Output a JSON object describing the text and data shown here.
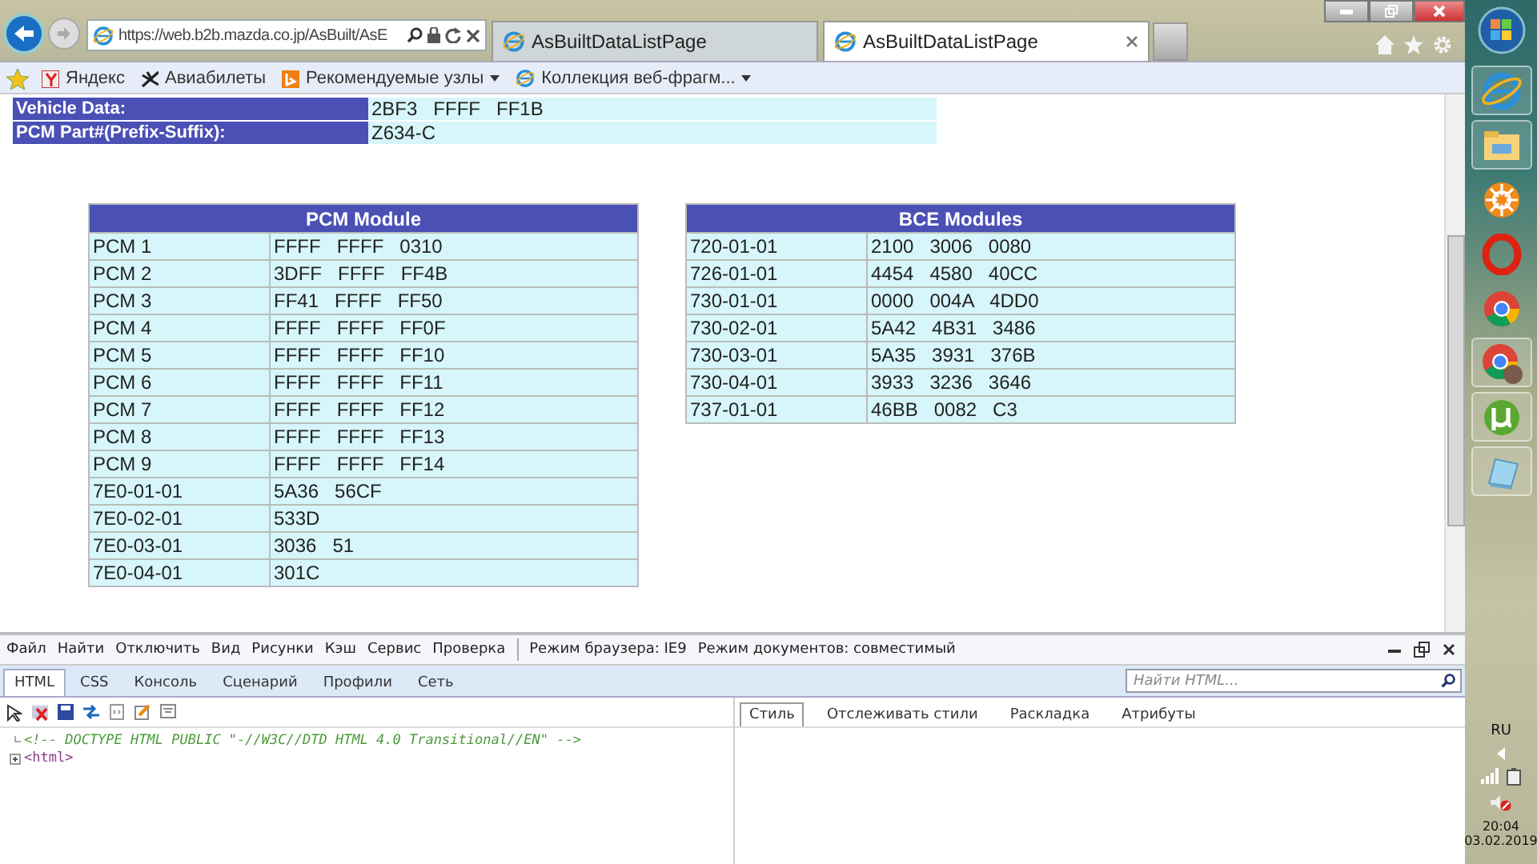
{
  "browser": {
    "address": "https://web.b2b.mazda.co.jp/AsBuilt/AsE",
    "tabs": [
      {
        "label": "AsBuiltDataListPage",
        "selected": false
      },
      {
        "label": "AsBuiltDataListPage",
        "selected": true
      }
    ]
  },
  "favorites": [
    {
      "label": "Яндекс",
      "kind": "link"
    },
    {
      "label": "Авиабилеты",
      "kind": "link"
    },
    {
      "label": "Рекомендуемые узлы",
      "kind": "menu"
    },
    {
      "label": "Коллекция веб-фрагм...",
      "kind": "menu"
    }
  ],
  "vehicle_info": [
    {
      "label": "Vehicle Data:",
      "value": "2BF3   FFFF   FF1B"
    },
    {
      "label": "PCM Part#(Prefix-Suffix):",
      "value": "Z634-C"
    }
  ],
  "modules": [
    {
      "title": "PCM Module",
      "rows": [
        [
          "PCM 1",
          "FFFF   FFFF   0310"
        ],
        [
          "PCM 2",
          "3DFF   FFFF   FF4B"
        ],
        [
          "PCM 3",
          "FF41   FFFF   FF50"
        ],
        [
          "PCM 4",
          "FFFF   FFFF   FF0F"
        ],
        [
          "PCM 5",
          "FFFF   FFFF   FF10"
        ],
        [
          "PCM 6",
          "FFFF   FFFF   FF11"
        ],
        [
          "PCM 7",
          "FFFF   FFFF   FF12"
        ],
        [
          "PCM 8",
          "FFFF   FFFF   FF13"
        ],
        [
          "PCM 9",
          "FFFF   FFFF   FF14"
        ],
        [
          "7E0-01-01",
          "5A36   56CF"
        ],
        [
          "7E0-02-01",
          "533D"
        ],
        [
          "7E0-03-01",
          "3036   51"
        ],
        [
          "7E0-04-01",
          "301C"
        ]
      ]
    },
    {
      "title": "BCE Modules",
      "rows": [
        [
          "720-01-01",
          "2100   3006   0080"
        ],
        [
          "726-01-01",
          "4454   4580   40CC"
        ],
        [
          "730-01-01",
          "0000   004A   4DD0"
        ],
        [
          "730-02-01",
          "5A42   4B31   3486"
        ],
        [
          "730-03-01",
          "5A35   3931   376B"
        ],
        [
          "730-04-01",
          "3933   3236   3646"
        ],
        [
          "737-01-01",
          "46BB   0082   C3"
        ]
      ]
    }
  ],
  "devtools": {
    "menu": [
      "Файл",
      "Найти",
      "Отключить",
      "Вид",
      "Рисунки",
      "Кэш",
      "Сервис",
      "Проверка"
    ],
    "browser_mode": "Режим браузера: IE9",
    "document_mode": "Режим документов: совместимый",
    "tabs": [
      {
        "label": "HTML",
        "selected": true
      },
      {
        "label": "CSS",
        "selected": false
      },
      {
        "label": "Консоль",
        "selected": false
      },
      {
        "label": "Сценарий",
        "selected": false
      },
      {
        "label": "Профили",
        "selected": false
      },
      {
        "label": "Сеть",
        "selected": false
      }
    ],
    "search": {
      "placeholder": "Найти HTML..."
    },
    "source_lines": [
      {
        "text": "<!-- DOCTYPE HTML PUBLIC \"-//W3C//DTD HTML 4.0 Transitional//EN\" -->",
        "kind": "comment"
      },
      {
        "text": "<html>",
        "kind": "tag"
      }
    ],
    "style_tabs": [
      {
        "label": "Стиль",
        "selected": true
      },
      {
        "label": "Отслеживать стили",
        "selected": false
      },
      {
        "label": "Раскладка",
        "selected": false
      },
      {
        "label": "Атрибуты",
        "selected": false
      }
    ]
  },
  "taskbar": {
    "language": "RU",
    "time": "20:04",
    "date": "03.02.2019"
  }
}
